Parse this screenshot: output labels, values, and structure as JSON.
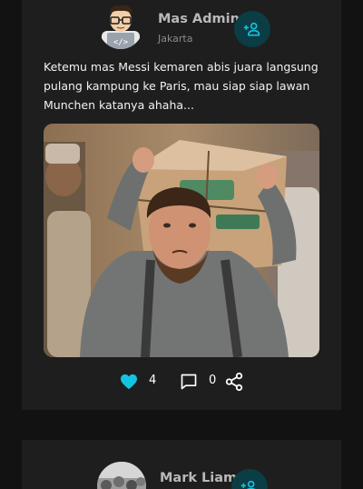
{
  "posts": [
    {
      "author": "Mas Admin",
      "location": "Jakarta",
      "text": "Ketemu mas Messi kemaren abis juara langsung pulang kampung ke Paris, mau siap siap lawan Munchen katanya ahaha...",
      "likes": "4",
      "comments": "0"
    },
    {
      "author": "Mark Liam"
    }
  ],
  "icons": {
    "follow": "person-add-icon",
    "like": "heart-icon",
    "comment": "comment-icon",
    "share": "share-icon"
  },
  "colors": {
    "accent": "#15c3e0",
    "follow_bg": "#0b3d45",
    "card_bg": "#1e1e1e",
    "page_bg": "#121212"
  }
}
